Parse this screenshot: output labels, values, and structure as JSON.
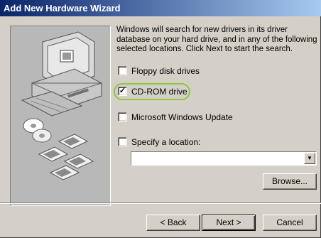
{
  "window": {
    "title": "Add New Hardware Wizard"
  },
  "description": "Windows will search for new drivers in its driver database on your hard drive, and in any of the following selected locations. Click Next to start the search.",
  "options": [
    {
      "label": "Floppy disk drives",
      "accel": "F",
      "checked": false
    },
    {
      "label": "CD-ROM drive",
      "accel": "C",
      "checked": true
    },
    {
      "label": "Microsoft Windows Update",
      "accel": "M",
      "checked": false
    },
    {
      "label": "Specify a location:",
      "accel": "l",
      "checked": false
    }
  ],
  "location": {
    "value": ""
  },
  "buttons": {
    "browse": "Browse...",
    "back": "< Back",
    "next": "Next >",
    "cancel": "Cancel"
  },
  "colors": {
    "titlebar_start": "#0a246a",
    "titlebar_end": "#a6caf0",
    "dialog": "#d4d0c8",
    "highlight": "#8dc63f"
  }
}
